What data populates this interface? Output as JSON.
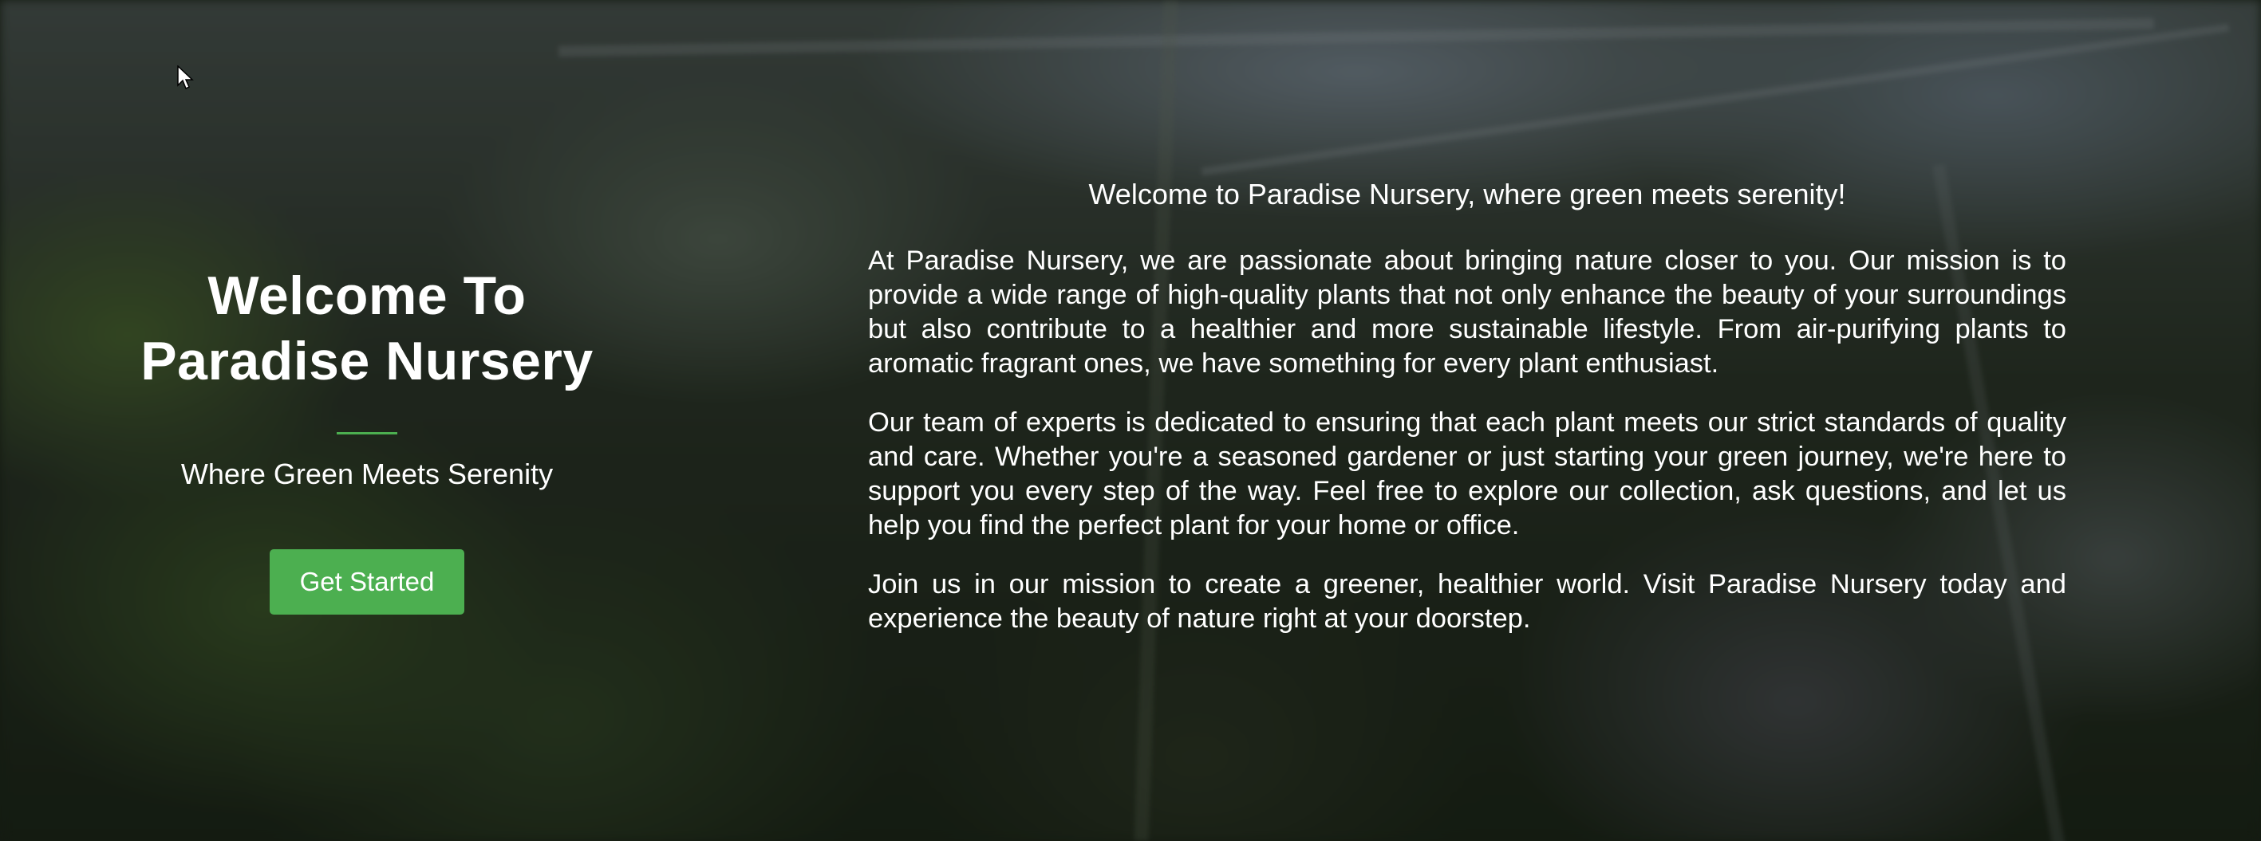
{
  "hero": {
    "title_line1": "Welcome To",
    "title_line2": "Paradise Nursery",
    "tagline": "Where Green Meets Serenity",
    "cta_label": "Get Started",
    "accent_color": "#4caf50"
  },
  "about": {
    "intro": "Welcome to Paradise Nursery, where green meets serenity!",
    "paragraphs": [
      "At Paradise Nursery, we are passionate about bringing nature closer to you. Our mission is to provide a wide range of high-quality plants that not only enhance the beauty of your surroundings but also contribute to a healthier and more sustainable lifestyle. From air-purifying plants to aromatic fragrant ones, we have something for every plant enthusiast.",
      "Our team of experts is dedicated to ensuring that each plant meets our strict standards of quality and care. Whether you're a seasoned gardener or just starting your green journey, we're here to support you every step of the way. Feel free to explore our collection, ask questions, and let us help you find the perfect plant for your home or office.",
      "Join us in our mission to create a greener, healthier world. Visit Paradise Nursery today and experience the beauty of nature right at your doorstep."
    ]
  },
  "cursor_icon": "mouse-pointer-icon"
}
